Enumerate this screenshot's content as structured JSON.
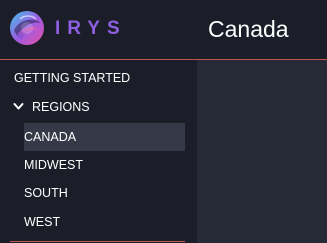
{
  "brand": {
    "name": "IRYS",
    "logo_icon": "irys-logo-icon",
    "accent": "#8e5fe0"
  },
  "sidebar": {
    "items": [
      {
        "label": "GETTING STARTED"
      },
      {
        "label": "REGIONS",
        "expanded": true,
        "icon": "chevron-down-icon",
        "children": [
          {
            "label": "CANADA",
            "active": true
          },
          {
            "label": "MIDWEST"
          },
          {
            "label": "SOUTH"
          },
          {
            "label": "WEST"
          }
        ]
      }
    ]
  },
  "header": {
    "title": "Canada"
  },
  "colors": {
    "sidebar_bg": "#1b1e29",
    "main_bg": "#262a37",
    "active_bg": "#363948",
    "divider": "#c0574e",
    "text": "#ffffff"
  }
}
